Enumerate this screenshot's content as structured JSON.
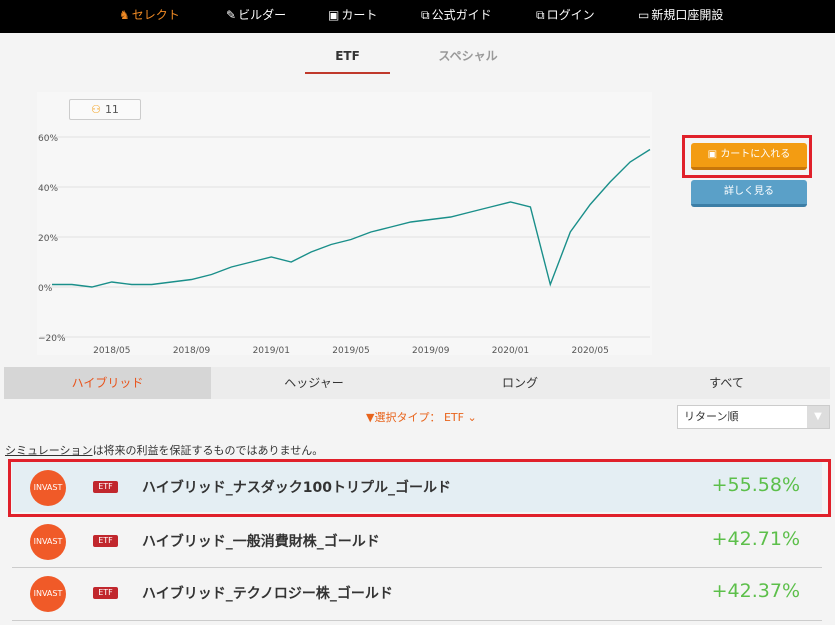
{
  "nav": {
    "items": [
      {
        "label": "セレクト",
        "icon": "strategy-icon"
      },
      {
        "label": "ビルダー",
        "icon": "wrench-icon"
      },
      {
        "label": "カート",
        "icon": "cart-icon"
      },
      {
        "label": "公式ガイド",
        "icon": "external-link-icon"
      },
      {
        "label": "ログイン",
        "icon": "external-link-icon"
      },
      {
        "label": "新規口座開設",
        "icon": "monitor-icon"
      }
    ]
  },
  "subtabs": [
    "ETF",
    "スペシャル"
  ],
  "badge": {
    "count": "11",
    "icon": "users-icon"
  },
  "chart_data": {
    "type": "line",
    "ylim": [
      -20,
      60
    ],
    "yticks": [
      "60%",
      "40%",
      "20%",
      "0%",
      "−20%"
    ],
    "xticks": [
      "2018/05",
      "2018/09",
      "2019/01",
      "2019/05",
      "2019/09",
      "2020/01",
      "2020/05"
    ],
    "line_color": "#1a8f8a",
    "series": [
      {
        "x": [
          "2018/02",
          "2018/03",
          "2018/04",
          "2018/05",
          "2018/06",
          "2018/07",
          "2018/08",
          "2018/09",
          "2018/10",
          "2018/11",
          "2018/12",
          "2019/01",
          "2019/02",
          "2019/03",
          "2019/04",
          "2019/05",
          "2019/06",
          "2019/07",
          "2019/08",
          "2019/09",
          "2019/10",
          "2019/11",
          "2019/12",
          "2020/01",
          "2020/02",
          "2020/03",
          "2020/04",
          "2020/05",
          "2020/06",
          "2020/07",
          "2020/08"
        ],
        "values": [
          1,
          1,
          0,
          2,
          1,
          1,
          2,
          3,
          5,
          8,
          10,
          12,
          10,
          14,
          17,
          19,
          22,
          24,
          26,
          27,
          28,
          30,
          32,
          34,
          32,
          1,
          22,
          33,
          42,
          50,
          55
        ]
      }
    ]
  },
  "buttons": {
    "cart": "カートに入れる",
    "detail": "詳しく見る"
  },
  "categories": [
    "ハイブリッド",
    "ヘッジャー",
    "ロング",
    "すべて"
  ],
  "filter": {
    "label": "選択タイプ： ETF"
  },
  "sort": {
    "selected": "リターン順"
  },
  "disclaimer": {
    "link": "シミュレーション",
    "text": "は将来の利益を保証するものではありません。"
  },
  "strategies": [
    {
      "logo": "INVAST",
      "badge": "ETF",
      "name": "ハイブリッド_ナスダック100トリプル_ゴールド",
      "return": "+55.58%"
    },
    {
      "logo": "INVAST",
      "badge": "ETF",
      "name": "ハイブリッド_一般消費財株_ゴールド",
      "return": "+42.71%"
    },
    {
      "logo": "INVAST",
      "badge": "ETF",
      "name": "ハイブリッド_テクノロジー株_ゴールド",
      "return": "+42.37%"
    }
  ]
}
